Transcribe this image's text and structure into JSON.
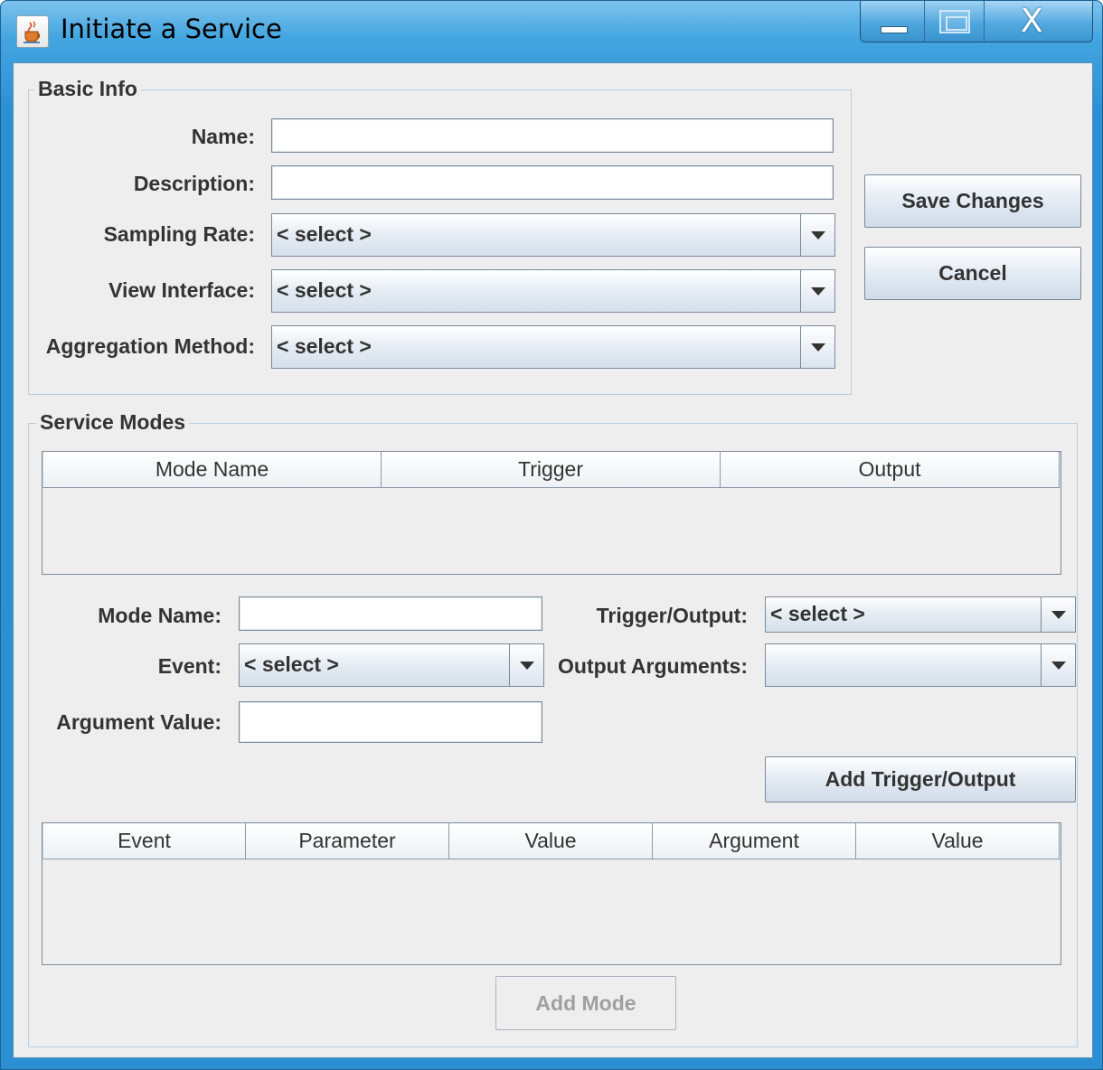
{
  "window": {
    "title": "Initiate a Service",
    "icon": "java-cup-icon",
    "controls": {
      "minimize": "minimize-icon",
      "maximize": "maximize-icon",
      "close": "X"
    }
  },
  "basic_info": {
    "title": "Basic Info",
    "name_label": "Name:",
    "name_value": "",
    "description_label": "Description:",
    "description_value": "",
    "sampling_rate_label": "Sampling Rate:",
    "sampling_rate_value": "< select >",
    "view_interface_label": "View Interface:",
    "view_interface_value": "< select >",
    "aggregation_label": "Aggregation Method:",
    "aggregation_value": "< select >"
  },
  "actions": {
    "save_label": "Save Changes",
    "cancel_label": "Cancel"
  },
  "service_modes": {
    "title": "Service Modes",
    "modes_table": {
      "columns": [
        "Mode Name",
        "Trigger",
        "Output"
      ],
      "rows": []
    },
    "mode_name_label": "Mode Name:",
    "mode_name_value": "",
    "event_label": "Event:",
    "event_value": "< select >",
    "argument_value_label": "Argument Value:",
    "argument_value_value": "",
    "trigger_output_label": "Trigger/Output:",
    "trigger_output_value": "< select >",
    "output_arguments_label": "Output Arguments:",
    "output_arguments_value": "",
    "add_trigger_label": "Add Trigger/Output",
    "events_table": {
      "columns": [
        "Event",
        "Parameter",
        "Value",
        "Argument",
        "Value"
      ],
      "rows": []
    },
    "add_mode_label": "Add Mode"
  }
}
